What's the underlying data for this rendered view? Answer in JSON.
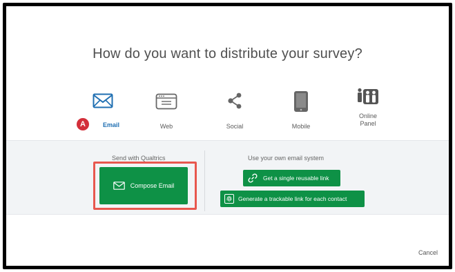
{
  "dialog": {
    "title": "How do you want to distribute your survey?",
    "cancel_label": "Cancel"
  },
  "channels": [
    {
      "id": "email",
      "label": "Email",
      "icon": "envelope-icon",
      "selected": true
    },
    {
      "id": "web",
      "label": "Web",
      "icon": "browser-window-icon",
      "selected": false
    },
    {
      "id": "social",
      "label": "Social",
      "icon": "share-icon",
      "selected": false
    },
    {
      "id": "mobile",
      "label": "Mobile",
      "icon": "tablet-icon",
      "selected": false
    },
    {
      "id": "online_panel",
      "label": "Online\nPanel",
      "icon": "people-icon",
      "selected": false
    }
  ],
  "badge": {
    "text": "A"
  },
  "email_options": {
    "qualtrics_label": "Send with Qualtrics",
    "compose_label": "Compose Email",
    "own_system_label": "Use your own email system",
    "reusable_link_label": "Get a single reusable link",
    "trackable_link_label": "Generate a trackable link for each contact"
  },
  "colors": {
    "accent": "#1f6fb2",
    "button_green": "#0e9146",
    "highlight": "#e8574e",
    "badge": "#d32f3a"
  }
}
